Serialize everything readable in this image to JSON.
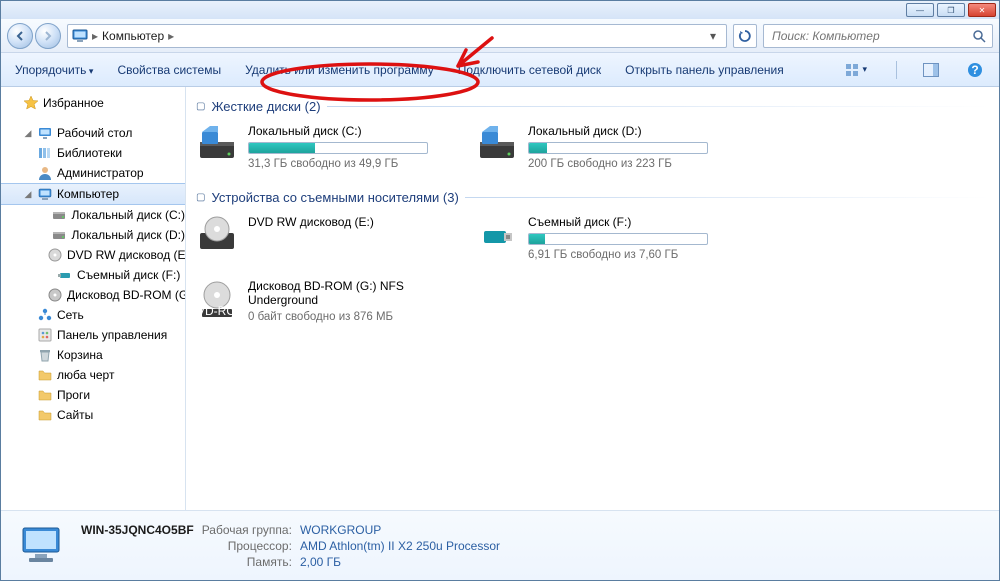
{
  "breadcrumb": {
    "root": "Компьютер"
  },
  "search": {
    "placeholder": "Поиск: Компьютер"
  },
  "toolbar": {
    "organize": "Упорядочить",
    "props": "Свойства системы",
    "uninstall": "Удалить или изменить программу",
    "mapdrive": "Подключить сетевой диск",
    "cpanel": "Открыть панель управления"
  },
  "sidebar": {
    "favorites": "Избранное",
    "items": [
      {
        "label": "Рабочий стол",
        "icon": "desktop"
      },
      {
        "label": "Библиотеки",
        "icon": "libraries"
      },
      {
        "label": "Администратор",
        "icon": "user"
      },
      {
        "label": "Компьютер",
        "icon": "computer",
        "selected": true
      },
      {
        "label": "Локальный диск (C:)",
        "icon": "hdd",
        "indent": 2
      },
      {
        "label": "Локальный диск (D:)",
        "icon": "hdd",
        "indent": 2
      },
      {
        "label": "DVD RW дисковод (E:)",
        "icon": "optical",
        "indent": 2
      },
      {
        "label": "Съемный диск (F:)",
        "icon": "usb",
        "indent": 2
      },
      {
        "label": "Дисковод BD-ROM (G:)",
        "icon": "bdrom",
        "indent": 2
      },
      {
        "label": "Сеть",
        "icon": "network"
      },
      {
        "label": "Панель управления",
        "icon": "cpanel"
      },
      {
        "label": "Корзина",
        "icon": "recycle"
      },
      {
        "label": "люба черт",
        "icon": "folder"
      },
      {
        "label": "Проги",
        "icon": "folder"
      },
      {
        "label": "Сайты",
        "icon": "folder"
      }
    ]
  },
  "groups": {
    "hdds": {
      "title": "Жесткие диски (2)",
      "items": [
        {
          "name": "Локальный диск (C:)",
          "sub": "31,3 ГБ свободно из 49,9 ГБ",
          "fill": 37
        },
        {
          "name": "Локальный диск (D:)",
          "sub": "200 ГБ свободно из 223 ГБ",
          "fill": 10
        }
      ]
    },
    "removable": {
      "title": "Устройства со съемными носителями (3)",
      "items": [
        {
          "name": "DVD RW дисковод (E:)",
          "sub": "",
          "type": "optical"
        },
        {
          "name": "Съемный диск (F:)",
          "sub": "6,91 ГБ свободно из 7,60 ГБ",
          "fill": 9,
          "type": "usb"
        },
        {
          "name": "Дисковод BD-ROM (G:) NFS Underground",
          "sub": "0 байт свободно из 876 МБ",
          "type": "bdrom"
        }
      ]
    }
  },
  "details": {
    "name": "WIN-35JQNC4O5BF",
    "workgroup_label": "Рабочая группа:",
    "workgroup": "WORKGROUP",
    "cpu_label": "Процессор:",
    "cpu": "AMD Athlon(tm) II X2 250u Processor",
    "ram_label": "Память:",
    "ram": "2,00 ГБ"
  }
}
